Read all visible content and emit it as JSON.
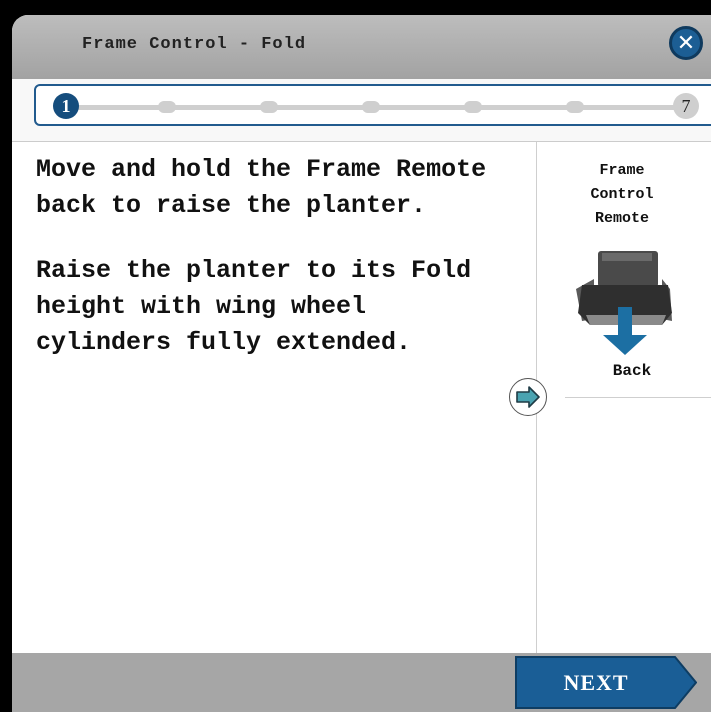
{
  "window": {
    "title": "Frame Control - Fold",
    "close_icon": "close-x-icon"
  },
  "steps": {
    "current": "1",
    "total": "7",
    "count": 7
  },
  "instructions": {
    "paragraph1": "Move and hold the Frame Remote back to raise the planter.",
    "paragraph2": "Raise the planter to its Fold height with wing wheel cylinders fully extended."
  },
  "side_panel": {
    "title_line1": "Frame",
    "title_line2": "Control",
    "title_line3": "Remote",
    "direction_label": "Back",
    "remote_icon": "frame-remote-icon",
    "direction_icon": "arrow-down-icon",
    "expand_icon": "arrow-right-icon"
  },
  "footer": {
    "next_label": "NEXT"
  },
  "colors": {
    "accent_blue": "#1c5e94",
    "step_active": "#154d7d",
    "arrow_teal": "#4aa3b1",
    "titlebar_gray": "#a9a9a9"
  }
}
